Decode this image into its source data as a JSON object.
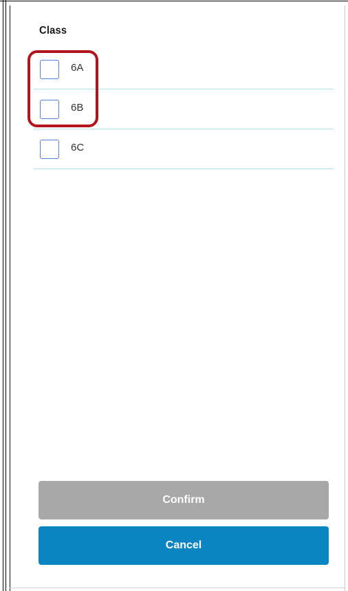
{
  "filter": {
    "section_title": "Class",
    "options": [
      {
        "label": "6A",
        "checked": false
      },
      {
        "label": "6B",
        "checked": false
      },
      {
        "label": "6C",
        "checked": false
      }
    ]
  },
  "actions": {
    "confirm_label": "Confirm",
    "cancel_label": "Cancel"
  },
  "colors": {
    "checkbox_border": "#5a7fd6",
    "row_divider": "#b9dfe3",
    "confirm_bg": "#a8a8a8",
    "cancel_bg": "#0b85c2",
    "highlight_annotation": "#b0141c"
  }
}
